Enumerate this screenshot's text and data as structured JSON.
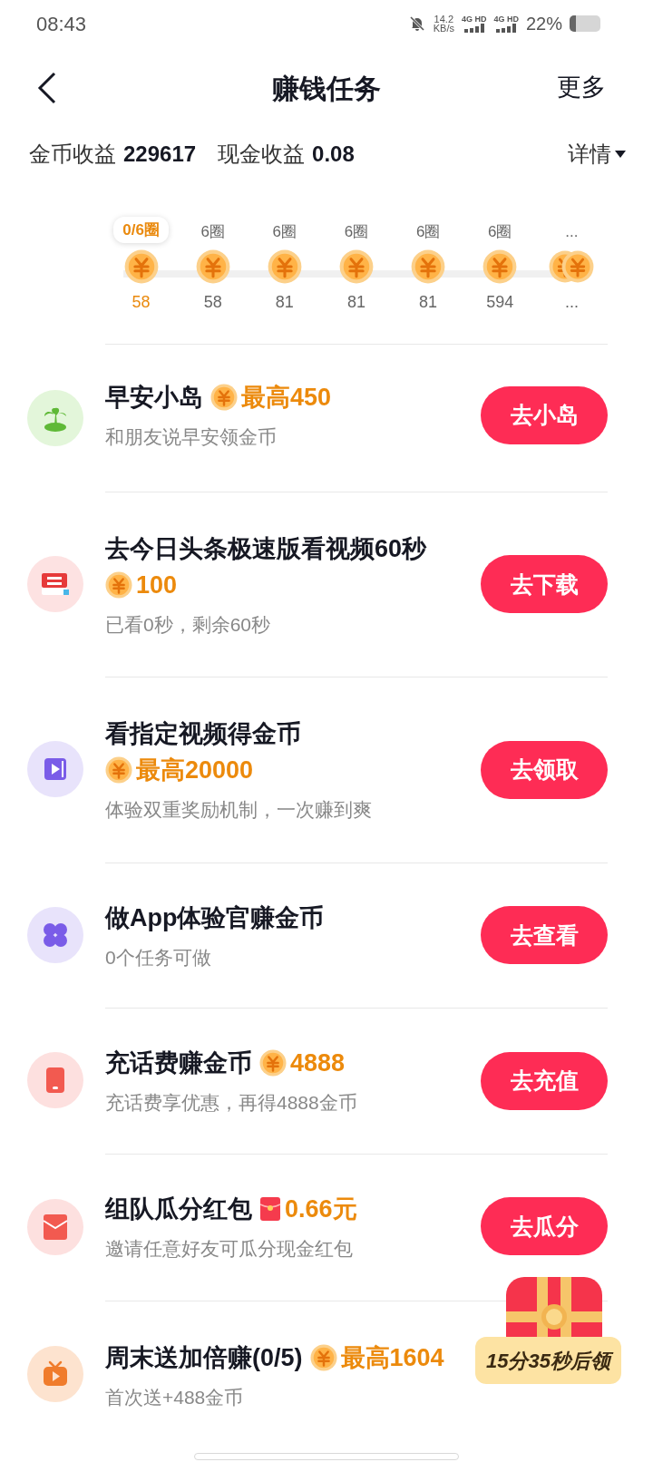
{
  "status_bar": {
    "time": "08:43",
    "speed": "14.2",
    "speed_unit": "KB/s",
    "net_1": "4G HD",
    "net_2": "4G HD",
    "battery": "22%"
  },
  "header": {
    "title": "赚钱任务",
    "more": "更多"
  },
  "earnings": {
    "coin_label": "金币收益",
    "coin_value": "229617",
    "cash_label": "现金收益",
    "cash_value": "0.08",
    "details": "详情"
  },
  "progress_steps": [
    {
      "label": "0/6圈",
      "value": "58",
      "selected": true,
      "kind": "single"
    },
    {
      "label": "6圈",
      "value": "58",
      "selected": false,
      "kind": "single"
    },
    {
      "label": "6圈",
      "value": "81",
      "selected": false,
      "kind": "single"
    },
    {
      "label": "6圈",
      "value": "81",
      "selected": false,
      "kind": "single"
    },
    {
      "label": "6圈",
      "value": "81",
      "selected": false,
      "kind": "single"
    },
    {
      "label": "6圈",
      "value": "594",
      "selected": false,
      "kind": "single"
    },
    {
      "label": "...",
      "value": "...",
      "selected": false,
      "kind": "double"
    }
  ],
  "tasks": [
    {
      "title": "早安小岛",
      "reward": {
        "kind": "coin",
        "amount": "最高450"
      },
      "subtitle": "和朋友说早安领金币",
      "button": "去小岛"
    },
    {
      "title": "去今日头条极速版看视频60秒",
      "reward": {
        "kind": "coin",
        "amount": "100"
      },
      "subtitle": "已看0秒，剩余60秒",
      "button": "去下载"
    },
    {
      "title": "看指定视频得金币",
      "reward": {
        "kind": "coin",
        "amount": "最高20000"
      },
      "subtitle": "体验双重奖励机制，一次赚到爽",
      "button": "去领取"
    },
    {
      "title": "做App体验官赚金币",
      "subtitle": "0个任务可做",
      "button": "去查看"
    },
    {
      "title": "充话费赚金币",
      "reward": {
        "kind": "coin",
        "amount": "4888"
      },
      "subtitle": "充话费享优惠，再得4888金币",
      "button": "去充值"
    },
    {
      "title": "组队瓜分红包",
      "reward": {
        "kind": "packet",
        "amount": "0.66元"
      },
      "subtitle": "邀请任意好友可瓜分现金红包",
      "button": "去瓜分"
    },
    {
      "title": "周末送加倍赚(0/5)",
      "reward": {
        "kind": "coin",
        "amount": "最高1604"
      },
      "subtitle": "首次送+488金币"
    }
  ],
  "floating_chest": {
    "countdown": "15分35秒后领"
  }
}
